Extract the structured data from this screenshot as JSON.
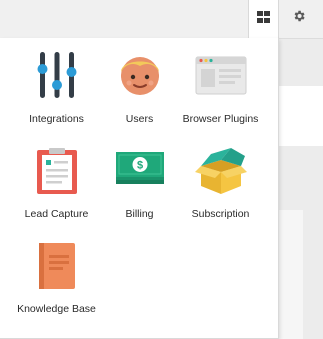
{
  "header": {
    "apps_icon": "grid-icon",
    "settings_icon": "gear-icon"
  },
  "menu": {
    "items": [
      {
        "label": "Integrations",
        "icon": "sliders-icon"
      },
      {
        "label": "Users",
        "icon": "user-face-icon"
      },
      {
        "label": "Browser Plugins",
        "icon": "browser-window-icon"
      },
      {
        "label": "Lead Capture",
        "icon": "clipboard-icon"
      },
      {
        "label": "Billing",
        "icon": "money-stack-icon"
      },
      {
        "label": "Subscription",
        "icon": "box-icon"
      },
      {
        "label": "Knowledge Base",
        "icon": "book-icon"
      }
    ]
  },
  "colors": {
    "slider_dark": "#333d47",
    "slider_blue": "#2c9bd6",
    "face": "#e8906a",
    "hair": "#f3c95a",
    "clipboard_red": "#e85a4f",
    "money_green": "#1fa87a",
    "box_yellow": "#f5c542",
    "box_teal": "#2bb39b",
    "book_orange": "#ef8a5a"
  }
}
